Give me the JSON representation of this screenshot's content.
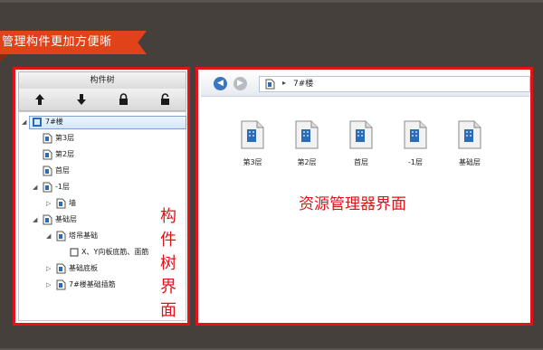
{
  "banner": {
    "title": "管理构件更加方便晰"
  },
  "tree_panel": {
    "title": "构件树",
    "toolbar": [
      {
        "name": "move-up-icon"
      },
      {
        "name": "move-down-icon"
      },
      {
        "name": "lock-icon"
      },
      {
        "name": "unlock-icon"
      }
    ],
    "nodes": [
      {
        "label": "7#楼",
        "selected": true
      },
      {
        "label": "第3层"
      },
      {
        "label": "第2层"
      },
      {
        "label": "首层"
      },
      {
        "label": "-1层"
      },
      {
        "label": "墙"
      },
      {
        "label": "基础层"
      },
      {
        "label": "塔吊基础"
      },
      {
        "label": "X、Y向板底筋、面筋"
      },
      {
        "label": "基础底板"
      },
      {
        "label": "7#楼基础插筋"
      }
    ],
    "annotation": [
      "构",
      "件",
      "树",
      "界",
      "面"
    ]
  },
  "explorer": {
    "back_label": "◀",
    "forward_label": "▶",
    "path": "7#楼",
    "separator": "▸",
    "items": [
      {
        "label": "第3层"
      },
      {
        "label": "第2层"
      },
      {
        "label": "首层"
      },
      {
        "label": "-1层"
      },
      {
        "label": "基础层"
      }
    ],
    "annotation": "资源管理器界面"
  },
  "colors": {
    "accent": "#e2121a",
    "banner": "#e0421a",
    "background": "#46403d"
  }
}
